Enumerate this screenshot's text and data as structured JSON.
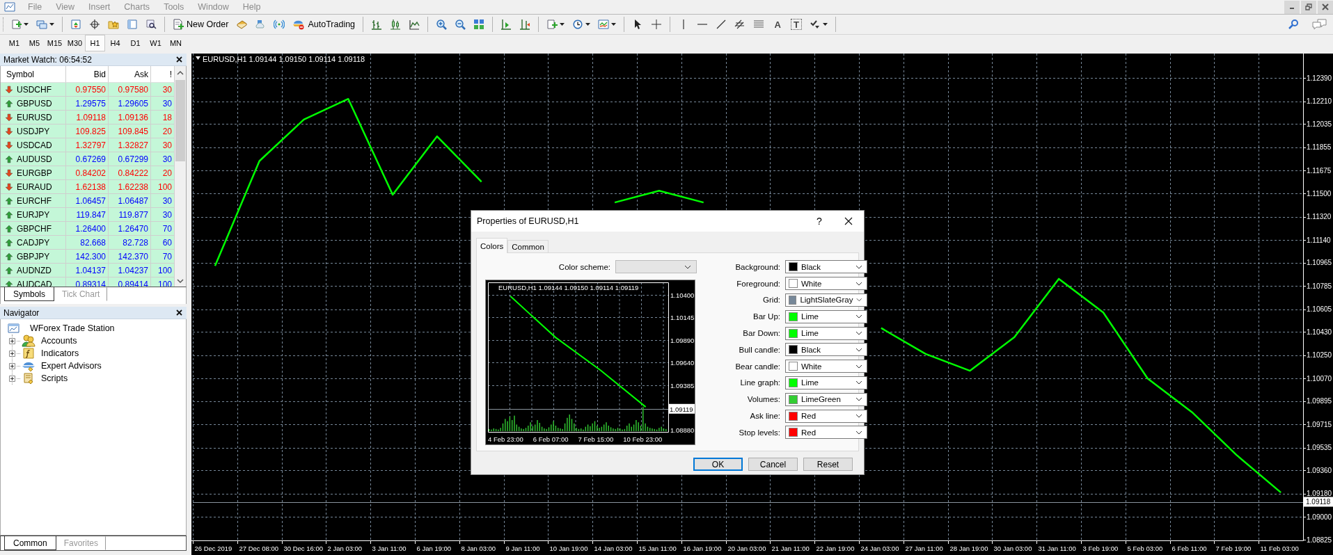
{
  "menu": [
    "File",
    "View",
    "Insert",
    "Charts",
    "Tools",
    "Window",
    "Help"
  ],
  "toolbar": {
    "new_order": "New Order",
    "autotrading": "AutoTrading",
    "text_tool": "A",
    "text_label_tool": "T"
  },
  "timeframes": [
    {
      "label": "M1",
      "selected": false
    },
    {
      "label": "M5",
      "selected": false
    },
    {
      "label": "M15",
      "selected": false
    },
    {
      "label": "M30",
      "selected": false
    },
    {
      "label": "H1",
      "selected": true
    },
    {
      "label": "H4",
      "selected": false
    },
    {
      "label": "D1",
      "selected": false
    },
    {
      "label": "W1",
      "selected": false
    },
    {
      "label": "MN",
      "selected": false
    }
  ],
  "market_watch": {
    "title": "Market Watch: 06:54:52",
    "columns": [
      "Symbol",
      "Bid",
      "Ask",
      "!"
    ],
    "rows": [
      {
        "symbol": "USDCHF",
        "bid": "0.97550",
        "ask": "0.97580",
        "spread": "30",
        "kind": "down"
      },
      {
        "symbol": "GBPUSD",
        "bid": "1.29575",
        "ask": "1.29605",
        "spread": "30",
        "kind": "up"
      },
      {
        "symbol": "EURUSD",
        "bid": "1.09118",
        "ask": "1.09136",
        "spread": "18",
        "kind": "down"
      },
      {
        "symbol": "USDJPY",
        "bid": "109.825",
        "ask": "109.845",
        "spread": "20",
        "kind": "down"
      },
      {
        "symbol": "USDCAD",
        "bid": "1.32797",
        "ask": "1.32827",
        "spread": "30",
        "kind": "down"
      },
      {
        "symbol": "AUDUSD",
        "bid": "0.67269",
        "ask": "0.67299",
        "spread": "30",
        "kind": "up"
      },
      {
        "symbol": "EURGBP",
        "bid": "0.84202",
        "ask": "0.84222",
        "spread": "20",
        "kind": "down"
      },
      {
        "symbol": "EURAUD",
        "bid": "1.62138",
        "ask": "1.62238",
        "spread": "100",
        "kind": "down"
      },
      {
        "symbol": "EURCHF",
        "bid": "1.06457",
        "ask": "1.06487",
        "spread": "30",
        "kind": "up"
      },
      {
        "symbol": "EURJPY",
        "bid": "119.847",
        "ask": "119.877",
        "spread": "30",
        "kind": "up"
      },
      {
        "symbol": "GBPCHF",
        "bid": "1.26400",
        "ask": "1.26470",
        "spread": "70",
        "kind": "up"
      },
      {
        "symbol": "CADJPY",
        "bid": "82.668",
        "ask": "82.728",
        "spread": "60",
        "kind": "up"
      },
      {
        "symbol": "GBPJPY",
        "bid": "142.300",
        "ask": "142.370",
        "spread": "70",
        "kind": "up"
      },
      {
        "symbol": "AUDNZD",
        "bid": "1.04137",
        "ask": "1.04237",
        "spread": "100",
        "kind": "up"
      },
      {
        "symbol": "AUDCAD",
        "bid": "0.89314",
        "ask": "0.89414",
        "spread": "100",
        "kind": "up"
      }
    ],
    "tabs": [
      {
        "label": "Symbols",
        "selected": true
      },
      {
        "label": "Tick Chart",
        "selected": false
      }
    ]
  },
  "navigator": {
    "title": "Navigator",
    "root": {
      "label": "WForex Trade Station",
      "children": [
        {
          "label": "Accounts",
          "kind": "accounts",
          "expanded": false
        },
        {
          "label": "Indicators",
          "kind": "indicators",
          "expanded": false
        },
        {
          "label": "Expert Advisors",
          "kind": "experts",
          "expanded": false
        },
        {
          "label": "Scripts",
          "kind": "scripts",
          "expanded": false
        }
      ]
    },
    "tabs": [
      {
        "label": "Common",
        "selected": true
      },
      {
        "label": "Favorites",
        "selected": false
      }
    ]
  },
  "chart": {
    "chart_data": {
      "type": "line",
      "title": "EURUSD,H1  1.09144 1.09150 1.09114 1.09118",
      "categories": [
        "26 Dec 2019",
        "27 Dec 08:00",
        "30 Dec 16:00",
        "2 Jan 03:00",
        "3 Jan 11:00",
        "6 Jan 19:00",
        "8 Jan 03:00",
        "9 Jan 11:00",
        "10 Jan 19:00",
        "14 Jan 03:00",
        "15 Jan 11:00",
        "16 Jan 19:00",
        "20 Jan 03:00",
        "21 Jan 11:00",
        "22 Jan 19:00",
        "24 Jan 03:00",
        "27 Jan 11:00",
        "28 Jan 19:00",
        "30 Jan 03:00",
        "31 Jan 11:00",
        "3 Feb 19:00",
        "5 Feb 03:00",
        "6 Feb 11:00",
        "7 Feb 19:00",
        "11 Feb 03:00"
      ],
      "values": [
        1.1094,
        1.1175,
        1.1207,
        1.1223,
        1.1149,
        1.1194,
        1.1159,
        null,
        null,
        1.1143,
        1.1152,
        1.1143,
        null,
        null,
        null,
        1.1046,
        1.1026,
        1.1013,
        1.1039,
        1.1084,
        1.1058,
        1.1007,
        1.0981,
        1.0948,
        1.0919
      ],
      "ylim": [
        1.0882,
        1.1258
      ],
      "yticks": [
        {
          "value": 1.1239,
          "label": "1.12390"
        },
        {
          "value": 1.1221,
          "label": "1.12210"
        },
        {
          "value": 1.12035,
          "label": "1.12035"
        },
        {
          "value": 1.11855,
          "label": "1.11855"
        },
        {
          "value": 1.11675,
          "label": "1.11675"
        },
        {
          "value": 1.115,
          "label": "1.11500"
        },
        {
          "value": 1.1132,
          "label": "1.11320"
        },
        {
          "value": 1.1114,
          "label": "1.11140"
        },
        {
          "value": 1.10965,
          "label": "1.10965"
        },
        {
          "value": 1.10785,
          "label": "1.10785"
        },
        {
          "value": 1.10605,
          "label": "1.10605"
        },
        {
          "value": 1.1043,
          "label": "1.10430"
        },
        {
          "value": 1.1025,
          "label": "1.10250"
        },
        {
          "value": 1.1007,
          "label": "1.10070"
        },
        {
          "value": 1.09895,
          "label": "1.09895"
        },
        {
          "value": 1.09715,
          "label": "1.09715"
        },
        {
          "value": 1.09535,
          "label": "1.09535"
        },
        {
          "value": 1.0936,
          "label": "1.09360"
        },
        {
          "value": 1.0918,
          "label": "1.09180"
        },
        {
          "value": 1.09,
          "label": "1.09000"
        },
        {
          "value": 1.08825,
          "label": "1.08825"
        }
      ],
      "grid": true,
      "ref_lines": [
        {
          "axis": "y",
          "value": 1.09118,
          "label": "1.09118",
          "color": "#8a949e"
        }
      ]
    }
  },
  "dialog": {
    "title": "Properties of EURUSD,H1",
    "help": "?",
    "tabs": [
      {
        "label": "Colors",
        "selected": true
      },
      {
        "label": "Common",
        "selected": false
      }
    ],
    "color_scheme": {
      "label": "Color scheme:"
    },
    "preview": {
      "chart_data": {
        "type": "line",
        "title": "EURUSD,H1  1.09144 1.09150 1.09114 1.09119",
        "categories": [
          "4 Feb 23:00",
          "6 Feb 07:00",
          "7 Feb 15:00",
          "10 Feb 23:00"
        ],
        "values": [
          1.1038,
          1.0992,
          1.0955,
          1.0914
        ],
        "ylim": [
          1.0886,
          1.1056
        ],
        "yticks": [
          {
            "value": 1.104,
            "label": "1.10400"
          },
          {
            "value": 1.10145,
            "label": "1.10145"
          },
          {
            "value": 1.0989,
            "label": "1.09890"
          },
          {
            "value": 1.0964,
            "label": "1.09640"
          },
          {
            "value": 1.09385,
            "label": "1.09385"
          },
          {
            "value": 1.0888,
            "label": "1.08880"
          }
        ],
        "grid": true,
        "ref_lines": [
          {
            "axis": "y",
            "value": 1.09119,
            "label": "1.09119",
            "color": "#8a949e"
          }
        ]
      }
    },
    "properties": [
      {
        "label": "Background:",
        "value": "Black",
        "color": "#000000"
      },
      {
        "label": "Foreground:",
        "value": "White",
        "color": "#ffffff"
      },
      {
        "label": "Grid:",
        "value": "LightSlateGray",
        "color": "#778899"
      },
      {
        "label": "Bar Up:",
        "value": "Lime",
        "color": "#00ff00"
      },
      {
        "label": "Bar Down:",
        "value": "Lime",
        "color": "#00ff00"
      },
      {
        "label": "Bull candle:",
        "value": "Black",
        "color": "#000000"
      },
      {
        "label": "Bear candle:",
        "value": "White",
        "color": "#ffffff"
      },
      {
        "label": "Line graph:",
        "value": "Lime",
        "color": "#00ff00"
      },
      {
        "label": "Volumes:",
        "value": "LimeGreen",
        "color": "#32cd32"
      },
      {
        "label": "Ask line:",
        "value": "Red",
        "color": "#ff0000"
      },
      {
        "label": "Stop levels:",
        "value": "Red",
        "color": "#ff0000"
      }
    ],
    "buttons": [
      {
        "label": "OK",
        "kind": "default"
      },
      {
        "label": "Cancel",
        "kind": "normal"
      },
      {
        "label": "Reset",
        "kind": "normal"
      }
    ]
  }
}
